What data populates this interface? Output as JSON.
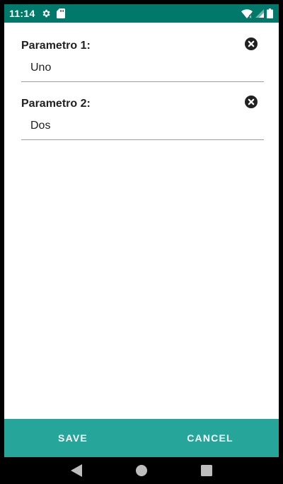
{
  "status_bar": {
    "time": "11:14",
    "icons": [
      "gear-icon",
      "sd-card-icon",
      "wifi-icon",
      "signal-icon",
      "battery-icon"
    ],
    "color": "#00796b"
  },
  "params": [
    {
      "label": "Parametro 1:",
      "value": "Uno"
    },
    {
      "label": "Parametro 2:",
      "value": "Dos"
    }
  ],
  "actions": {
    "save_label": "SAVE",
    "cancel_label": "CANCEL",
    "color": "#26a69a"
  },
  "nav": {
    "icons": [
      "back-icon",
      "home-icon",
      "recents-icon"
    ]
  }
}
